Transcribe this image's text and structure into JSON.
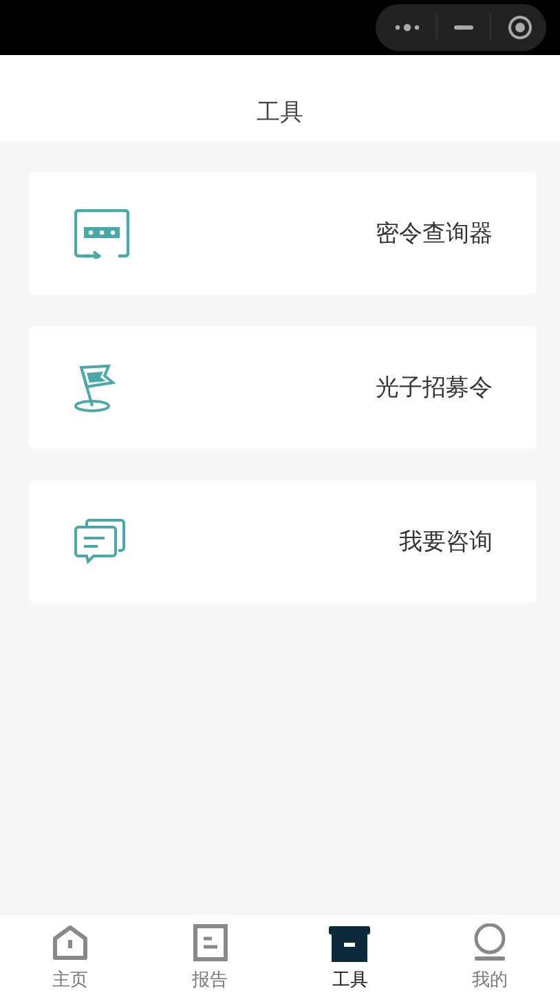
{
  "header": {
    "title": "工具"
  },
  "tools": [
    {
      "kind": "password",
      "label": "密令查询器"
    },
    {
      "kind": "flag",
      "label": "光子招募令"
    },
    {
      "kind": "chat",
      "label": "我要咨询"
    }
  ],
  "tab_bar": [
    {
      "kind": "home",
      "label": "主页",
      "selected": false
    },
    {
      "kind": "report",
      "label": "报告",
      "selected": false
    },
    {
      "kind": "tools",
      "label": "工具",
      "selected": true
    },
    {
      "kind": "me",
      "label": "我的",
      "selected": false
    }
  ]
}
